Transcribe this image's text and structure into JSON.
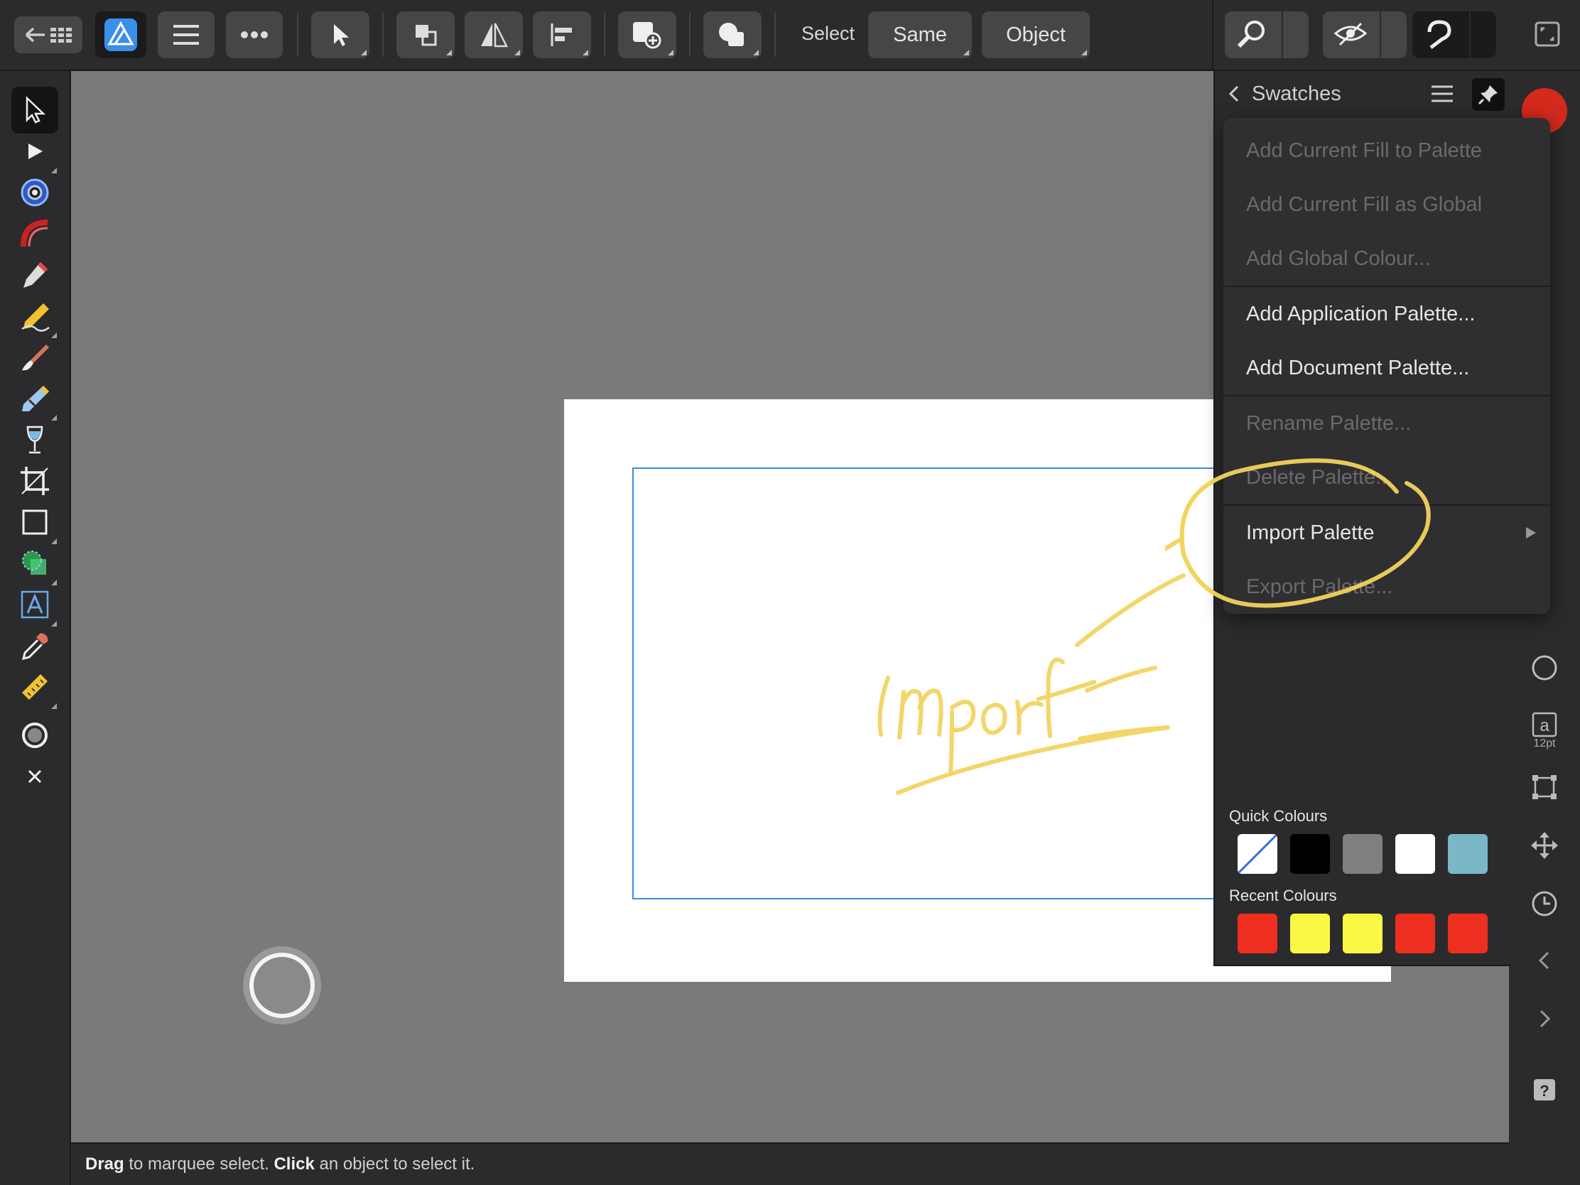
{
  "toolbar": {
    "select_label": "Select",
    "same_label": "Same",
    "object_label": "Object"
  },
  "swatches": {
    "title": "Swatches",
    "menu": [
      {
        "label": "Add Current Fill to Palette",
        "enabled": false
      },
      {
        "label": "Add Current Fill as Global",
        "enabled": false
      },
      {
        "label": "Add Global Colour...",
        "enabled": false
      },
      {
        "label": "Add Application Palette...",
        "enabled": true
      },
      {
        "label": "Add Document Palette...",
        "enabled": true
      },
      {
        "label": "Rename Palette...",
        "enabled": false
      },
      {
        "label": "Delete Palette...",
        "enabled": false
      },
      {
        "label": "Import Palette",
        "enabled": true,
        "submenu": true
      },
      {
        "label": "Export Palette...",
        "enabled": false
      }
    ],
    "quick_label": "Quick Colours",
    "quick_colours": [
      "none",
      "#000000",
      "#7f7f7f",
      "#ffffff",
      "#7ab8c8"
    ],
    "recent_label": "Recent Colours",
    "recent_colours": [
      "#ee2e1e",
      "#fbf745",
      "#fbf745",
      "#ee2e1e",
      "#ee2e1e"
    ]
  },
  "right_strip": {
    "current_fill": "#d32a1c",
    "text_size": "12pt"
  },
  "statusbar": {
    "drag": "Drag",
    "drag_rest": " to marquee select. ",
    "click": "Click",
    "click_rest": " an object to select it."
  },
  "annotation": {
    "handwritten_text": "Import",
    "color": "#f1d35c"
  },
  "colors": {
    "accent_blue": "#3b8de0",
    "app_bg": "#2b2b2d",
    "canvas_bg": "#7a7a7a"
  }
}
